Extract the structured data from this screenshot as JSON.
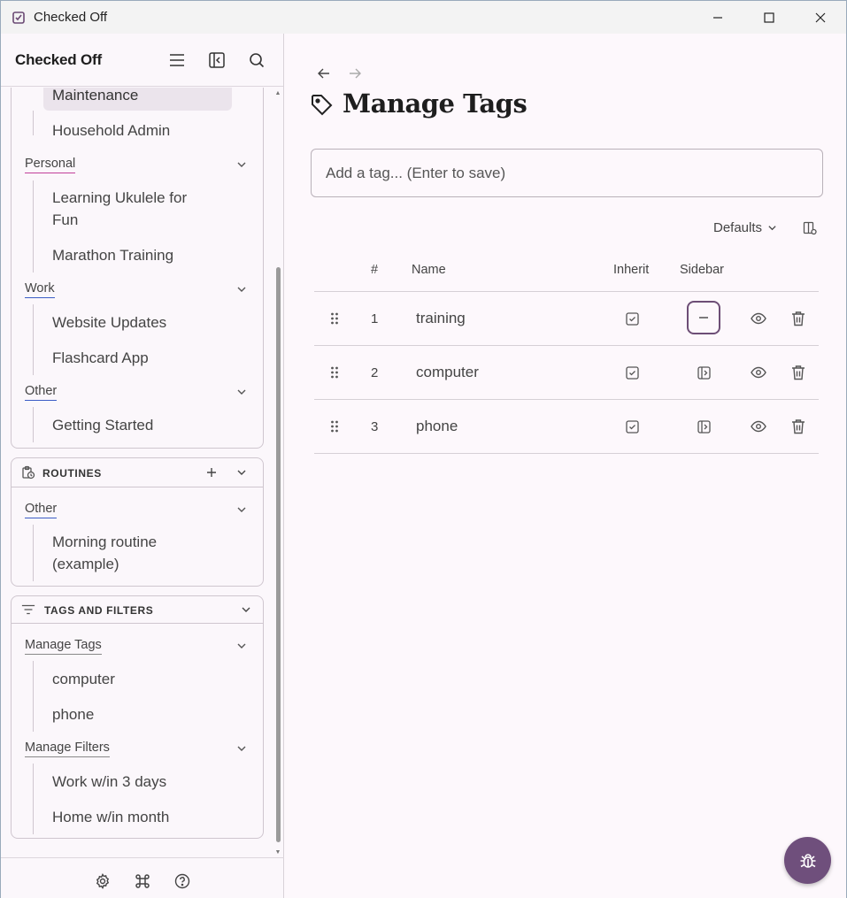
{
  "window": {
    "title": "Checked Off"
  },
  "sidebar": {
    "title": "Checked Off",
    "projects_groups": {
      "active_item": "Maintenance",
      "item_household": "Household Admin",
      "personal": {
        "label": "Personal",
        "color": "#c2409a",
        "items": [
          "Learning Ukulele for",
          "Fun",
          "Marathon Training"
        ]
      },
      "work": {
        "label": "Work",
        "color": "#3b5cc6",
        "items": [
          "Website Updates",
          "Flashcard App"
        ]
      },
      "other": {
        "label": "Other",
        "color": "#3b5cc6",
        "items": [
          "Getting Started"
        ]
      }
    },
    "routines": {
      "label": "ROUTINES",
      "other_label": "Other",
      "items": [
        "Morning routine",
        "(example)"
      ]
    },
    "tags_filters": {
      "label": "TAGS AND FILTERS",
      "manage_tags": "Manage Tags",
      "tags": [
        "computer",
        "phone"
      ],
      "manage_filters": "Manage Filters",
      "filters": [
        "Work w/in 3 days",
        "Home w/in month"
      ]
    }
  },
  "main": {
    "title": "Manage Tags",
    "input_placeholder": "Add a tag... (Enter to save)",
    "defaults_label": "Defaults",
    "columns": {
      "num": "#",
      "name": "Name",
      "inherit": "Inherit",
      "sidebar": "Sidebar"
    },
    "rows": [
      {
        "num": "1",
        "name": "training"
      },
      {
        "num": "2",
        "name": "computer"
      },
      {
        "num": "3",
        "name": "phone"
      }
    ]
  },
  "colors": {
    "accent": "#6f4f7c",
    "underline_default": "#888888"
  }
}
